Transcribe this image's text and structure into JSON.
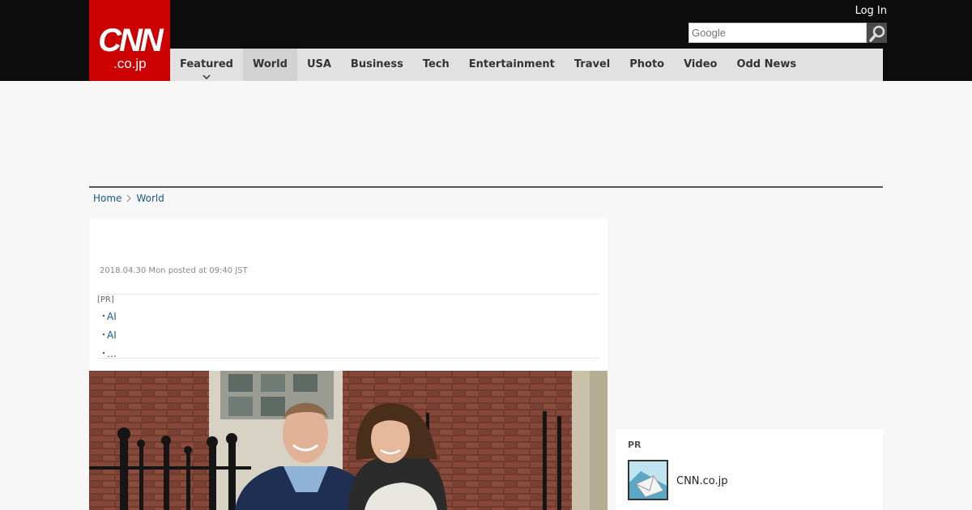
{
  "brand": {
    "logo_main": "CNN",
    "logo_sub": ".co.jp"
  },
  "header": {
    "login_label": "Log In"
  },
  "search": {
    "placeholder": "Google"
  },
  "nav": {
    "items": [
      {
        "label": "Featured"
      },
      {
        "label": "World"
      },
      {
        "label": "USA"
      },
      {
        "label": "Business"
      },
      {
        "label": "Tech"
      },
      {
        "label": "Entertainment"
      },
      {
        "label": "Travel"
      },
      {
        "label": "Photo"
      },
      {
        "label": "Video"
      },
      {
        "label": "Odd News"
      }
    ]
  },
  "breadcrumb": {
    "home": "Home",
    "section": "World"
  },
  "article": {
    "dateline": "2018.04.30 Mon posted at 09:40 JST",
    "pr_tag": "[PR]",
    "pr_links": [
      {
        "bullet": "・",
        "label": "AI"
      },
      {
        "bullet": "・",
        "label": "AI"
      },
      {
        "bullet": "・",
        "label": "…"
      }
    ]
  },
  "sidebar": {
    "pr_title": "PR",
    "pr_item_label": "CNN.co.jp"
  },
  "colors": {
    "brand_red": "#cc0000",
    "topbar": "#0c0c0c",
    "nav_bg": "#e1e1e1",
    "link": "#1a5a8a"
  },
  "icons": {
    "search": "magnifier-icon",
    "nav_caret": "chevron-down-icon",
    "breadcrumb_sep": "chevron-right-icon"
  }
}
